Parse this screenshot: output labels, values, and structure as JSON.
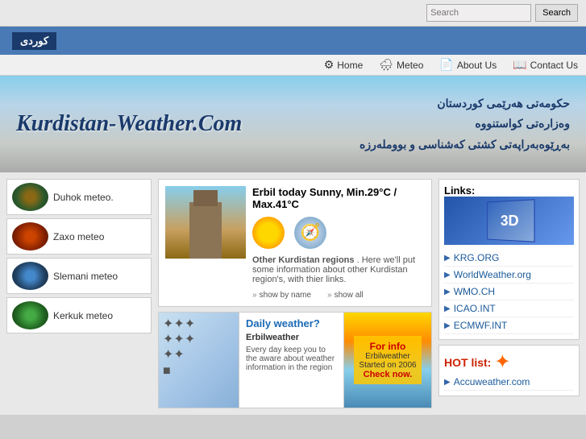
{
  "topbar": {
    "search_placeholder": "Search",
    "search_button_label": "Search"
  },
  "banner": {
    "kurdish_label": "كوردى"
  },
  "nav": {
    "items": [
      {
        "id": "home",
        "label": "Home",
        "icon": "⚙"
      },
      {
        "id": "meteo",
        "label": "Meteo",
        "icon": "🌧"
      },
      {
        "id": "about",
        "label": "About Us",
        "icon": "📄"
      },
      {
        "id": "contact",
        "label": "Contact Us",
        "icon": "📖"
      }
    ]
  },
  "hero": {
    "logo": "Kurdistan-Weather.Com",
    "text_line1": "حكومەتى هەرێمى كوردستان",
    "text_line2": "وەزارەتى كواستنووە",
    "text_line3": "بەڕێوەبەراپەتى كشتى كەشناسى و بووملەرزە"
  },
  "sidebar": {
    "items": [
      {
        "id": "duhok",
        "label": "Duhok meteo."
      },
      {
        "id": "zaxo",
        "label": "Zaxo meteo"
      },
      {
        "id": "slemani",
        "label": "Slemani meteo"
      },
      {
        "id": "kerkuk",
        "label": "Kerkuk meteo"
      }
    ]
  },
  "erbil_today": {
    "title": "Erbil today",
    "weather_desc": "Sunny, Min.29°C / Max.41°C",
    "other_regions_label": "Other Kurdistan regions",
    "other_regions_desc": ". Here we'll put some information about other Kurdistan region's, with thier links.",
    "show_by_name": "show by name",
    "show_all": "show all"
  },
  "daily_weather": {
    "title": "Daily weather?",
    "subtitle": "Erbilweather",
    "description": "Every day keep you to the aware about weather information in the region",
    "for_info": {
      "title": "For info",
      "subtitle": "Erbilweather",
      "detail": "Started on 2006",
      "cta": "Check now."
    }
  },
  "links": {
    "title": "Links:",
    "items": [
      {
        "id": "krg",
        "label": "KRG.ORG"
      },
      {
        "id": "worldweather",
        "label": "WorldWeather.org"
      },
      {
        "id": "wmo",
        "label": "WMO.CH"
      },
      {
        "id": "icao",
        "label": "ICAO.INT"
      },
      {
        "id": "ecmwf",
        "label": "ECMWF.INT"
      }
    ]
  },
  "hot_list": {
    "label": "HOT list:",
    "items": [
      {
        "id": "accuweather",
        "label": "Accuweather.com"
      }
    ]
  }
}
